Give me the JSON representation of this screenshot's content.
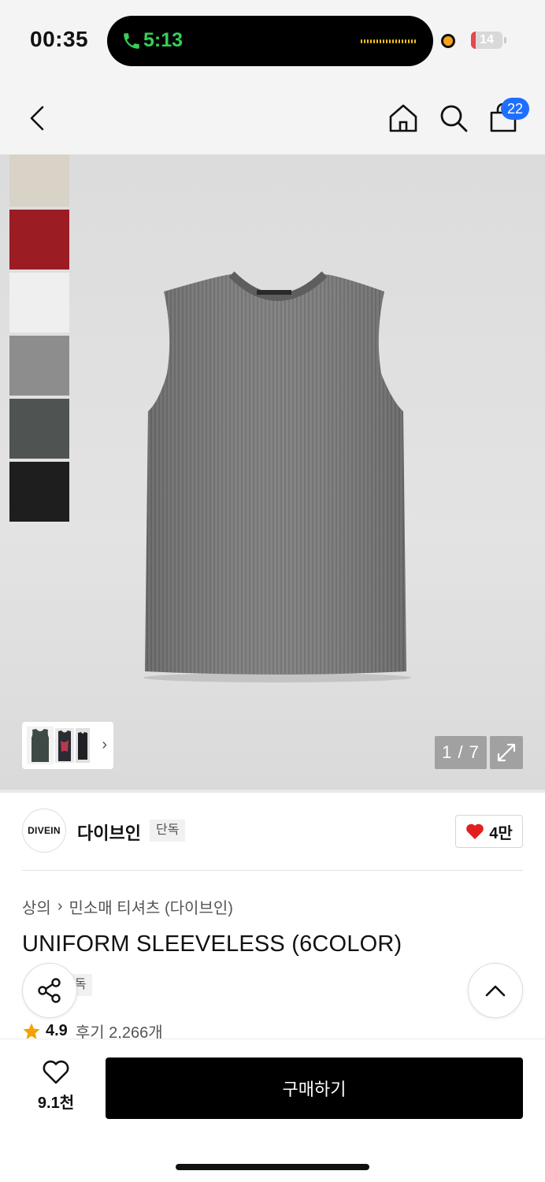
{
  "status_bar": {
    "time": "00:35",
    "call_time": "5:13",
    "battery": "14",
    "battery_level": 0.14,
    "battery_color": "#e5484d",
    "call_color": "#34d058"
  },
  "header": {
    "back_icon": "chevron-left-icon",
    "home_icon": "home-icon",
    "search_icon": "search-icon",
    "cart_icon": "shopping-bag-icon",
    "cart_count": "22",
    "badge_color": "#1f6fff"
  },
  "gallery": {
    "swatch_colors": [
      "#d9d2c7",
      "#9b1c22",
      "#efefef",
      "#8d8d8d",
      "#4f5452",
      "#1e1e1e"
    ],
    "counter": "1 / 7",
    "expand_icon": "expand-icon"
  },
  "brand": {
    "logo_text": "DIVEIN",
    "name": "다이브인",
    "tag": "단독",
    "like_count": "4만"
  },
  "product": {
    "breadcrumb": [
      "상의",
      "민소매 티셔츠 (다이브인)"
    ],
    "title": "UNIFORM SLEEVELESS (6COLOR)",
    "exclusive_tag": "단독",
    "rating": "4.9",
    "reviews": "후기 2,266개"
  },
  "bottom_bar": {
    "wish_count": "9.1천",
    "buy_label": "구매하기"
  }
}
